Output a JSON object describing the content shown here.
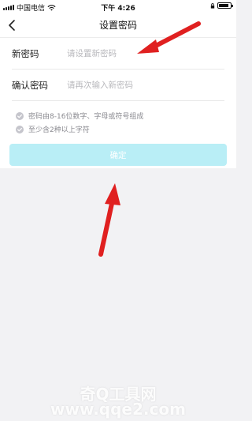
{
  "status_bar": {
    "carrier": "中国电信",
    "time": "下午 4:26",
    "battery_level": 0.85
  },
  "nav": {
    "title": "设置密码",
    "back_icon": "chevron-left-icon"
  },
  "form": {
    "new_password": {
      "label": "新密码",
      "placeholder": "请设置新密码",
      "value": ""
    },
    "confirm_password": {
      "label": "确认密码",
      "placeholder": "请再次输入新密码",
      "value": ""
    }
  },
  "rules": [
    {
      "text": "密码由8-16位数字、字母或符号组成",
      "icon": "check-circle-icon"
    },
    {
      "text": "至少含2种以上字符",
      "icon": "check-circle-icon"
    }
  ],
  "confirm_button": {
    "label": "确定",
    "enabled": false
  },
  "colors": {
    "accent": "#b9eef6",
    "check_icon": "#c5c5cc",
    "annotation_arrow": "#e02020"
  },
  "watermark": {
    "line1": "奇Q工具网",
    "line2": "www.qqe2.com"
  }
}
